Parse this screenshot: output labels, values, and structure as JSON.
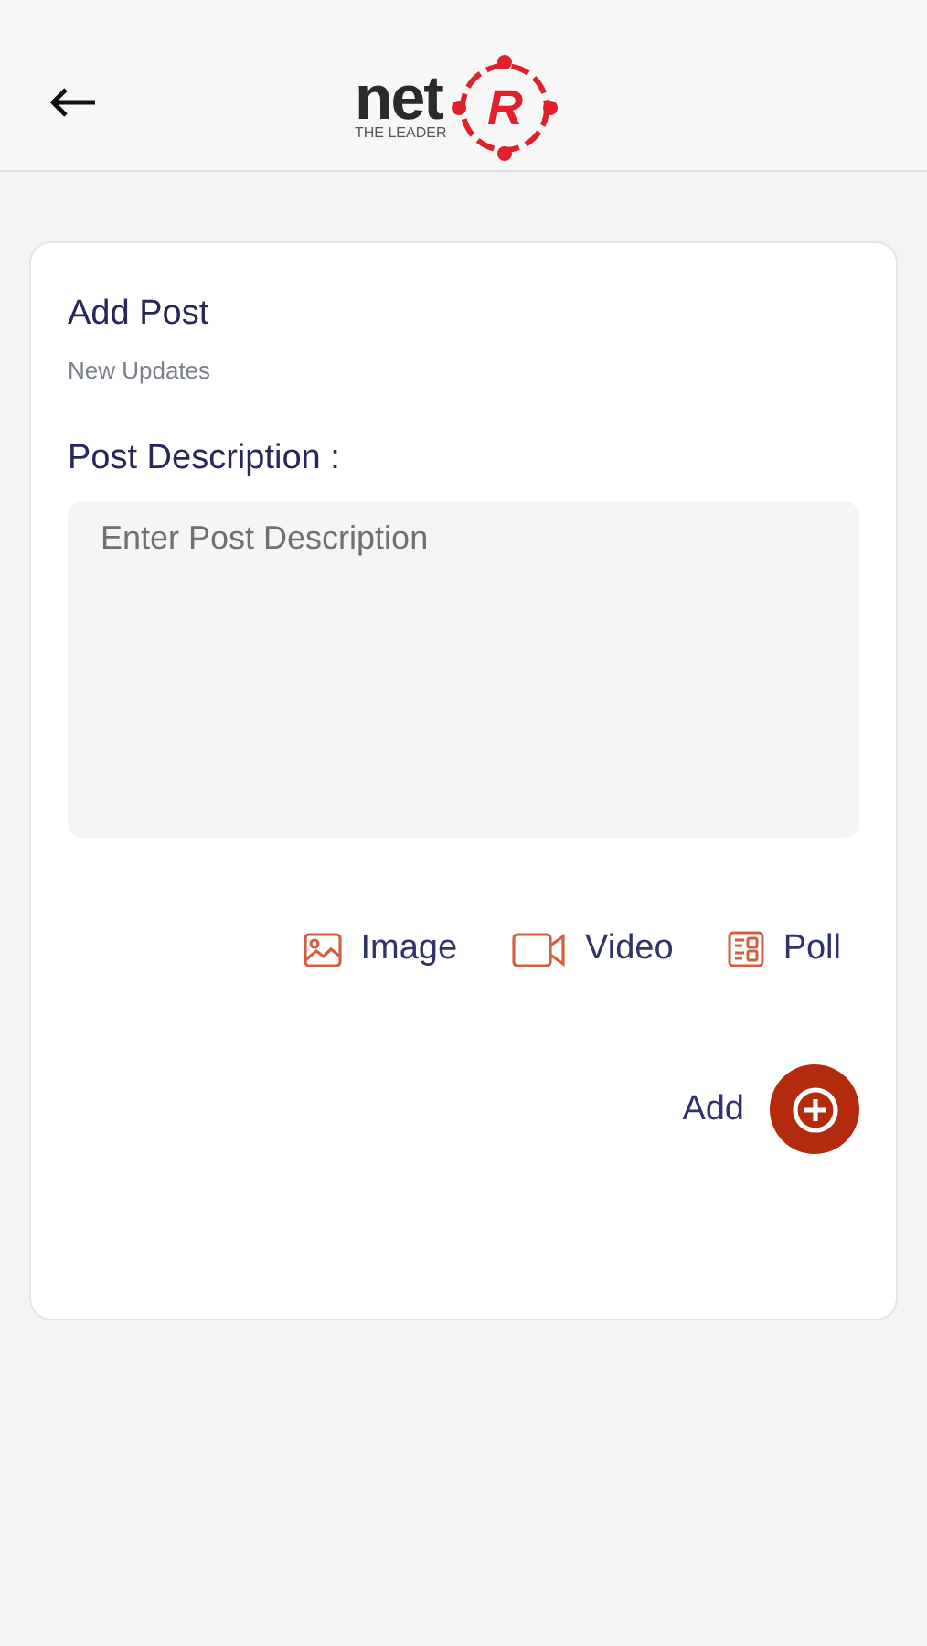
{
  "header": {
    "logo": {
      "word": "net",
      "letter": "R",
      "tagline": "THE LEADER"
    }
  },
  "card": {
    "title": "Add Post",
    "subtitle": "New Updates",
    "field_label": "Post Description :",
    "description": {
      "placeholder": "Enter Post Description"
    },
    "attachments": [
      {
        "kind": "image",
        "label": "Image"
      },
      {
        "kind": "video",
        "label": "Video"
      },
      {
        "kind": "poll",
        "label": "Poll"
      }
    ],
    "submit": {
      "label": "Add"
    }
  }
}
